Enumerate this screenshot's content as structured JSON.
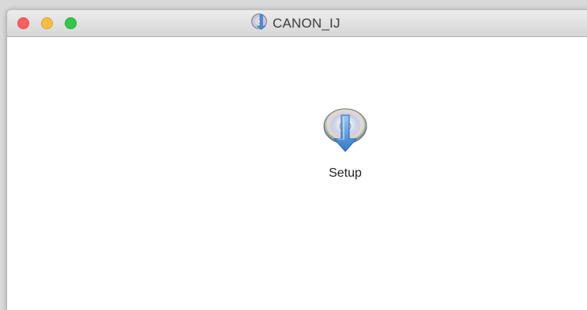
{
  "window": {
    "title": "CANON_IJ",
    "title_icon": "disc-image-icon"
  },
  "traffic_lights": {
    "close_color": "#fc605c",
    "minimize_color": "#fdbc40",
    "zoom_color": "#34c84a"
  },
  "content": {
    "items": [
      {
        "label": "Setup",
        "icon": "installer-disc-icon"
      }
    ]
  }
}
